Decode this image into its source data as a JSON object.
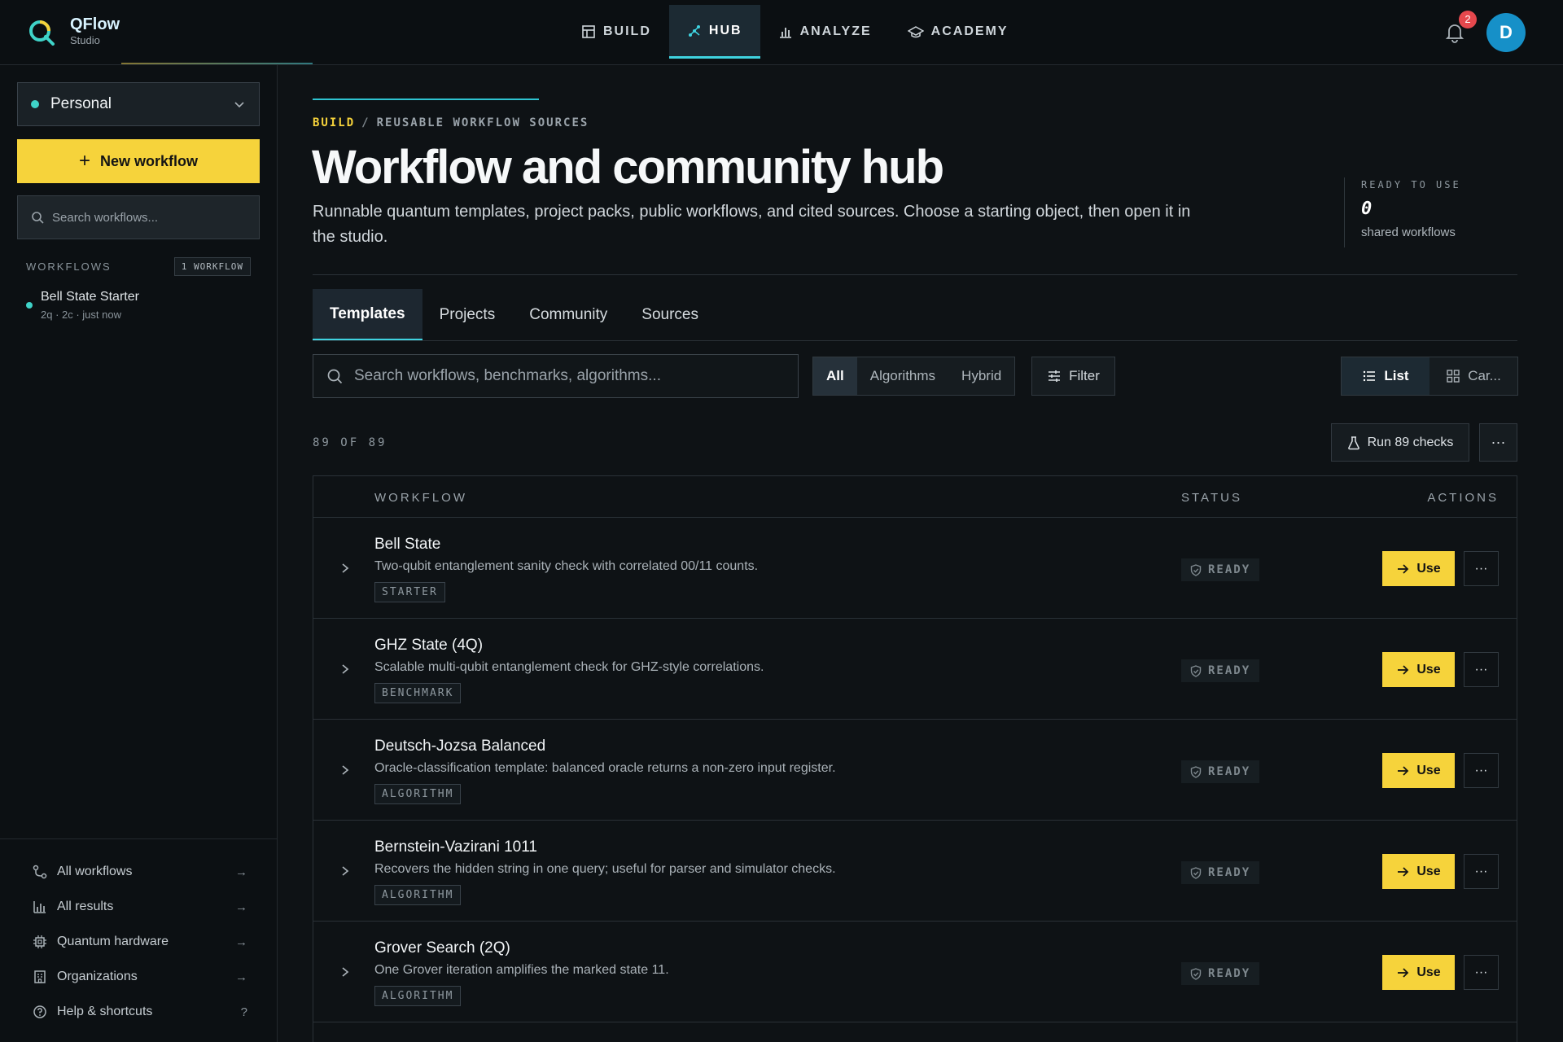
{
  "brand": {
    "name": "QFlow",
    "subtitle": "Studio"
  },
  "nav": [
    {
      "label": "BUILD",
      "icon": "layout-icon"
    },
    {
      "label": "HUB",
      "icon": "hub-icon"
    },
    {
      "label": "ANALYZE",
      "icon": "bar-chart-icon"
    },
    {
      "label": "ACADEMY",
      "icon": "graduation-cap-icon"
    }
  ],
  "notifications": {
    "count": "2"
  },
  "user": {
    "initial": "D"
  },
  "sidebar": {
    "space": "Personal",
    "new_workflow": "New workflow",
    "search_placeholder": "Search workflows...",
    "workflows_label": "WORKFLOWS",
    "workflows_count": "1 WORKFLOW",
    "items": [
      {
        "name": "Bell State Starter",
        "meta": "2q · 2c · just now"
      }
    ],
    "links": [
      {
        "label": "All workflows",
        "icon": "workflow-icon",
        "hint": "→"
      },
      {
        "label": "All results",
        "icon": "bar-chart-icon",
        "hint": "→"
      },
      {
        "label": "Quantum hardware",
        "icon": "chip-icon",
        "hint": "→"
      },
      {
        "label": "Organizations",
        "icon": "building-icon",
        "hint": "→"
      },
      {
        "label": "Help & shortcuts",
        "icon": "help-icon",
        "hint": "?"
      }
    ]
  },
  "main": {
    "breadcrumb": {
      "root": "BUILD",
      "separator": "/",
      "current": "REUSABLE WORKFLOW SOURCES"
    },
    "title": "Workflow and community hub",
    "description": "Runnable quantum templates, project packs, public workflows, and cited sources. Choose a starting object, then open it in the studio.",
    "ready": {
      "label": "READY TO USE",
      "value": "0",
      "sub": "shared workflows"
    },
    "tabs": [
      "Templates",
      "Projects",
      "Community",
      "Sources"
    ],
    "search_placeholder": "Search workflows, benchmarks, algorithms...",
    "segments": [
      "All",
      "Algorithms",
      "Hybrid"
    ],
    "filter_label": "Filter",
    "views": [
      "List",
      "Car..."
    ],
    "count": "89 OF 89",
    "run_checks": "Run 89 checks",
    "more": "···",
    "columns": {
      "workflow": "WORKFLOW",
      "status": "STATUS",
      "actions": "ACTIONS"
    },
    "rows": [
      {
        "title": "Bell State",
        "desc": "Two-qubit entanglement sanity check with correlated 00/11 counts.",
        "tag": "STARTER",
        "status": "READY",
        "action": "Use"
      },
      {
        "title": "GHZ State (4Q)",
        "desc": "Scalable multi-qubit entanglement check for GHZ-style correlations.",
        "tag": "BENCHMARK",
        "status": "READY",
        "action": "Use"
      },
      {
        "title": "Deutsch-Jozsa Balanced",
        "desc": "Oracle-classification template: balanced oracle returns a non-zero input register.",
        "tag": "ALGORITHM",
        "status": "READY",
        "action": "Use"
      },
      {
        "title": "Bernstein-Vazirani 1011",
        "desc": "Recovers the hidden string in one query; useful for parser and simulator checks.",
        "tag": "ALGORITHM",
        "status": "READY",
        "action": "Use"
      },
      {
        "title": "Grover Search (2Q)",
        "desc": "One Grover iteration amplifies the marked state 11.",
        "tag": "ALGORITHM",
        "status": "READY",
        "action": "Use"
      }
    ]
  },
  "colors": {
    "accent": "#f6d33b",
    "teal": "#3fd3e0",
    "background": "#0e1215"
  }
}
